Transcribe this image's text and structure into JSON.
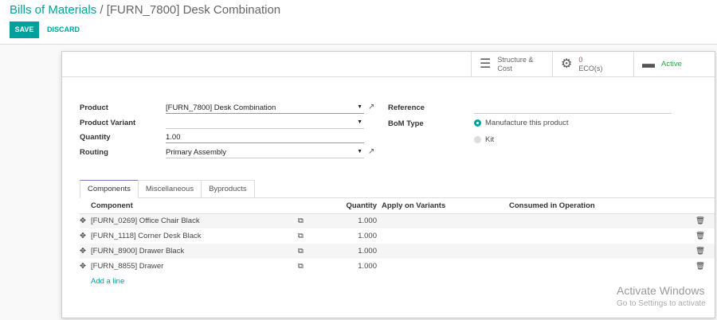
{
  "breadcrumb": {
    "parent": "Bills of Materials",
    "separator": "/",
    "current": "[FURN_7800] Desk Combination"
  },
  "toolbar": {
    "save": "SAVE",
    "discard": "DISCARD"
  },
  "smart_buttons": {
    "structure_line1": "Structure &",
    "structure_line2": "Cost",
    "eco_count": "0",
    "eco_label": "ECO(s)",
    "active": "Active"
  },
  "form": {
    "product_label": "Product",
    "product_value": "[FURN_7800] Desk Combination",
    "variant_label": "Product Variant",
    "variant_value": "",
    "quantity_label": "Quantity",
    "quantity_value": "1.00",
    "routing_label": "Routing",
    "routing_value": "Primary Assembly",
    "reference_label": "Reference",
    "reference_value": "",
    "bom_type_label": "BoM Type",
    "bom_type_options": [
      "Manufacture this product",
      "Kit"
    ]
  },
  "tabs": [
    "Components",
    "Miscellaneous",
    "Byproducts"
  ],
  "table": {
    "headers": [
      "Component",
      "Quantity",
      "Apply on Variants",
      "Consumed in Operation"
    ],
    "rows": [
      {
        "component": "[FURN_0269] Office Chair Black",
        "quantity": "1.000"
      },
      {
        "component": "[FURN_1118] Corner Desk Black",
        "quantity": "1.000"
      },
      {
        "component": "[FURN_8900] Drawer Black",
        "quantity": "1.000"
      },
      {
        "component": "[FURN_8855] Drawer",
        "quantity": "1.000"
      }
    ],
    "add_line": "Add a line"
  },
  "watermark": {
    "title": "Activate Windows",
    "subtitle": "Go to Settings to activate"
  }
}
